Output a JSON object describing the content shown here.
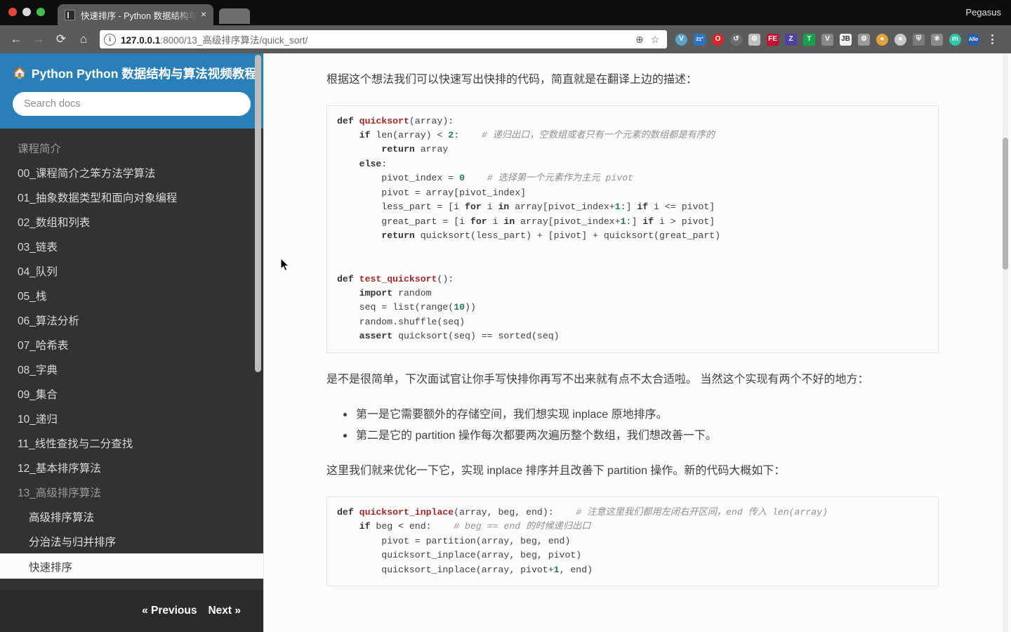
{
  "browser": {
    "profile_name": "Pegasus",
    "tab": {
      "title": "快速排序 - Python 数据结构与算法视频教程",
      "close_label": "×"
    },
    "toolbar": {
      "back_label": "←",
      "forward_label": "→",
      "reload_label": "⟳",
      "home_label": "⌂",
      "info_label": "i",
      "url_scheme_host": "127.0.0.1",
      "url_rest": ":8000/13_高级排序算法/quick_sort/",
      "zoom_label": "⊕",
      "bookmark_label": "☆",
      "menu_label": "⋮"
    },
    "extensions": [
      {
        "name": "vimium-icon",
        "glyph": "V",
        "bg": "#5aa3c4",
        "round": true
      },
      {
        "name": "weather-icon",
        "glyph": "21°",
        "bg": "#2f74c0",
        "round": false
      },
      {
        "name": "opera-icon",
        "glyph": "O",
        "bg": "#d9252a",
        "round": true
      },
      {
        "name": "refresh-extension-icon",
        "glyph": "↺",
        "bg": "#6e6e6e",
        "round": true
      },
      {
        "name": "gear-extension-icon",
        "glyph": "⚙",
        "bg": "#bfbfbf",
        "round": false
      },
      {
        "name": "feedly-icon",
        "glyph": "FE",
        "bg": "#c8102e",
        "round": false
      },
      {
        "name": "zotero-icon",
        "glyph": "Z",
        "bg": "#4b42a8",
        "round": false
      },
      {
        "name": "grammarly-icon",
        "glyph": "T",
        "bg": "#15a34a",
        "round": false
      },
      {
        "name": "vue-devtools-icon",
        "glyph": "V",
        "bg": "#8a8a8a",
        "round": false
      },
      {
        "name": "jetbrains-toolbox-icon",
        "glyph": "JB",
        "bg": "#f0f0f0",
        "round": false
      },
      {
        "name": "settings-extension-icon",
        "glyph": "⚙",
        "bg": "#9a9a9a",
        "round": false
      },
      {
        "name": "cookie-icon",
        "glyph": "●",
        "bg": "#e2a33e",
        "round": true
      },
      {
        "name": "circle-extension-icon",
        "glyph": "●",
        "bg": "#c9c9c9",
        "round": true
      },
      {
        "name": "shield-extension-icon",
        "glyph": "⛨",
        "bg": "#7b7b7b",
        "round": false
      },
      {
        "name": "react-devtools-icon",
        "glyph": "⚛",
        "bg": "#8c8c8c",
        "round": false
      },
      {
        "name": "momentum-icon",
        "glyph": "m",
        "bg": "#2ec7a8",
        "round": true
      },
      {
        "name": "allo-icon",
        "glyph": "Allo",
        "bg": "#2a5fa8",
        "round": false
      }
    ]
  },
  "sidebar": {
    "brand": "Python 数据结构与算法视频教程",
    "home_icon": "🏠",
    "search": {
      "placeholder": "Search docs",
      "value": ""
    },
    "items": [
      {
        "label": "课程简介",
        "style": "muted"
      },
      {
        "label": "00_课程简介之笨方法学算法",
        "style": "top"
      },
      {
        "label": "01_抽象数据类型和面向对象编程",
        "style": "top"
      },
      {
        "label": "02_数组和列表",
        "style": "top"
      },
      {
        "label": "03_链表",
        "style": "top"
      },
      {
        "label": "04_队列",
        "style": "top"
      },
      {
        "label": "05_栈",
        "style": "top"
      },
      {
        "label": "06_算法分析",
        "style": "top"
      },
      {
        "label": "07_哈希表",
        "style": "top"
      },
      {
        "label": "08_字典",
        "style": "top"
      },
      {
        "label": "09_集合",
        "style": "top"
      },
      {
        "label": "10_递归",
        "style": "top"
      },
      {
        "label": "11_线性查找与二分查找",
        "style": "top"
      },
      {
        "label": "12_基本排序算法",
        "style": "top"
      },
      {
        "label": "13_高级排序算法",
        "style": "muted"
      },
      {
        "label": "高级排序算法",
        "style": "sub"
      },
      {
        "label": "分治法与归并排序",
        "style": "sub"
      },
      {
        "label": "快速排序",
        "style": "current"
      }
    ],
    "footer": {
      "previous": "« Previous",
      "next": "Next »"
    }
  },
  "content": {
    "paragraph_1": "根据这个想法我们可以快速写出快排的代码，简直就是在翻译上边的描述：",
    "code_block_1": [
      [
        {
          "t": "def ",
          "c": "k"
        },
        {
          "t": "quicksort",
          "c": "fn"
        },
        {
          "t": "(array):",
          "c": "nb"
        }
      ],
      [
        {
          "t": "    ",
          "c": "nb"
        },
        {
          "t": "if ",
          "c": "k"
        },
        {
          "t": "len(array) < ",
          "c": "nb"
        },
        {
          "t": "2",
          "c": "n"
        },
        {
          "t": ":    ",
          "c": "nb"
        },
        {
          "t": "# 递归出口，空数组或者只有一个元素的数组都是有序的",
          "c": "c"
        }
      ],
      [
        {
          "t": "        ",
          "c": "nb"
        },
        {
          "t": "return ",
          "c": "k"
        },
        {
          "t": "array",
          "c": "nb"
        }
      ],
      [
        {
          "t": "    ",
          "c": "nb"
        },
        {
          "t": "else",
          "c": "k"
        },
        {
          "t": ":",
          "c": "nb"
        }
      ],
      [
        {
          "t": "        pivot_index = ",
          "c": "nb"
        },
        {
          "t": "0",
          "c": "n"
        },
        {
          "t": "    ",
          "c": "nb"
        },
        {
          "t": "# 选择第一个元素作为主元 pivot",
          "c": "c"
        }
      ],
      [
        {
          "t": "        pivot = array[pivot_index]",
          "c": "nb"
        }
      ],
      [
        {
          "t": "        less_part = [i ",
          "c": "nb"
        },
        {
          "t": "for ",
          "c": "k"
        },
        {
          "t": "i ",
          "c": "nb"
        },
        {
          "t": "in ",
          "c": "k"
        },
        {
          "t": "array[pivot_index+",
          "c": "nb"
        },
        {
          "t": "1",
          "c": "n"
        },
        {
          "t": ":] ",
          "c": "nb"
        },
        {
          "t": "if ",
          "c": "k"
        },
        {
          "t": "i <= pivot]",
          "c": "nb"
        }
      ],
      [
        {
          "t": "        great_part = [i ",
          "c": "nb"
        },
        {
          "t": "for ",
          "c": "k"
        },
        {
          "t": "i ",
          "c": "nb"
        },
        {
          "t": "in ",
          "c": "k"
        },
        {
          "t": "array[pivot_index+",
          "c": "nb"
        },
        {
          "t": "1",
          "c": "n"
        },
        {
          "t": ":] ",
          "c": "nb"
        },
        {
          "t": "if ",
          "c": "k"
        },
        {
          "t": "i > pivot]",
          "c": "nb"
        }
      ],
      [
        {
          "t": "        ",
          "c": "nb"
        },
        {
          "t": "return ",
          "c": "k"
        },
        {
          "t": "quicksort(less_part) + [pivot] + quicksort(great_part)",
          "c": "nb"
        }
      ],
      [
        {
          "t": "",
          "c": "nb"
        }
      ],
      [
        {
          "t": "",
          "c": "nb"
        }
      ],
      [
        {
          "t": "def ",
          "c": "k"
        },
        {
          "t": "test_quicksort",
          "c": "fn"
        },
        {
          "t": "():",
          "c": "nb"
        }
      ],
      [
        {
          "t": "    ",
          "c": "nb"
        },
        {
          "t": "import ",
          "c": "k"
        },
        {
          "t": "random",
          "c": "nb"
        }
      ],
      [
        {
          "t": "    seq = list(range(",
          "c": "nb"
        },
        {
          "t": "10",
          "c": "n"
        },
        {
          "t": "))",
          "c": "nb"
        }
      ],
      [
        {
          "t": "    random.shuffle(seq)",
          "c": "nb"
        }
      ],
      [
        {
          "t": "    ",
          "c": "nb"
        },
        {
          "t": "assert ",
          "c": "k"
        },
        {
          "t": "quicksort(seq) == sorted(seq)",
          "c": "nb"
        }
      ]
    ],
    "paragraph_2": "是不是很简单，下次面试官让你手写快排你再写不出来就有点不太合适啦。 当然这个实现有两个不好的地方：",
    "bullets": [
      "第一是它需要额外的存储空间，我们想实现 inplace 原地排序。",
      "第二是它的 partition 操作每次都要两次遍历整个数组，我们想改善一下。"
    ],
    "paragraph_3": "这里我们就来优化一下它，实现 inplace 排序并且改善下 partition 操作。新的代码大概如下：",
    "code_block_2": [
      [
        {
          "t": "def ",
          "c": "k"
        },
        {
          "t": "quicksort_inplace",
          "c": "fn"
        },
        {
          "t": "(array, beg, end):    ",
          "c": "nb"
        },
        {
          "t": "# 注意这里我们都用左闭右开区间，end 传入 len(array)",
          "c": "c"
        }
      ],
      [
        {
          "t": "    ",
          "c": "nb"
        },
        {
          "t": "if ",
          "c": "k"
        },
        {
          "t": "beg < end:    ",
          "c": "nb"
        },
        {
          "t": "# beg == end 的时候递归出口",
          "c": "c"
        }
      ],
      [
        {
          "t": "        pivot = partition(array, beg, end)",
          "c": "nb"
        }
      ],
      [
        {
          "t": "        quicksort_inplace(array, beg, pivot)",
          "c": "nb"
        }
      ],
      [
        {
          "t": "        quicksort_inplace(array, pivot+",
          "c": "nb"
        },
        {
          "t": "1",
          "c": "n"
        },
        {
          "t": ", end)",
          "c": "nb"
        }
      ]
    ]
  },
  "colors": {
    "sidebar_bg": "#343131",
    "sidebar_header_bg": "#2980b9",
    "sidebar_footer_bg": "#2b2b2b",
    "content_bg": "#fcfcfc",
    "text": "#404040",
    "code_comment": "#8f8f8f",
    "code_function": "#a62728",
    "code_number": "#208050"
  }
}
